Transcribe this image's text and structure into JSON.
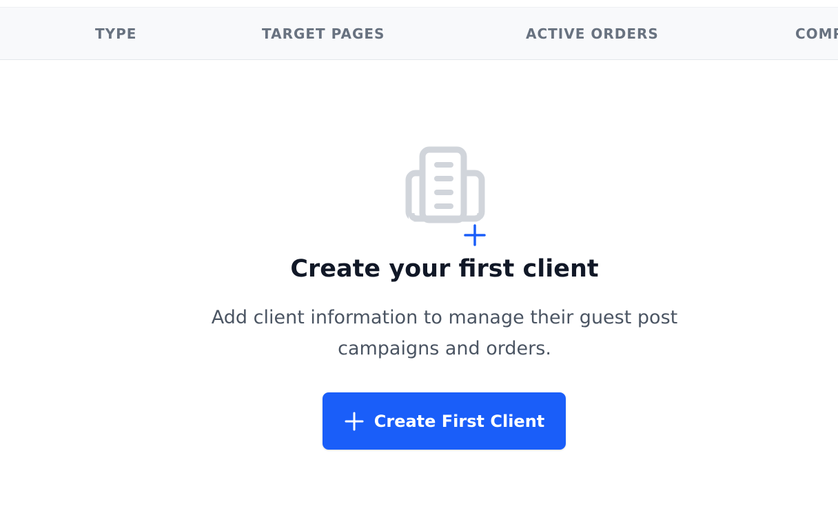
{
  "table": {
    "columns": [
      "TYPE",
      "TARGET PAGES",
      "ACTIVE ORDERS",
      "COMP"
    ]
  },
  "empty_state": {
    "icon": "office-building-plus-icon",
    "title": "Create your first client",
    "description": "Add client information to manage their guest post campaigns and orders.",
    "button_label": "Create First Client",
    "button_icon": "plus-icon"
  },
  "colors": {
    "accent": "#1a5ef9",
    "header_bg": "#f8f9fb",
    "header_text": "#687280",
    "icon_gray": "#d1d5db"
  }
}
